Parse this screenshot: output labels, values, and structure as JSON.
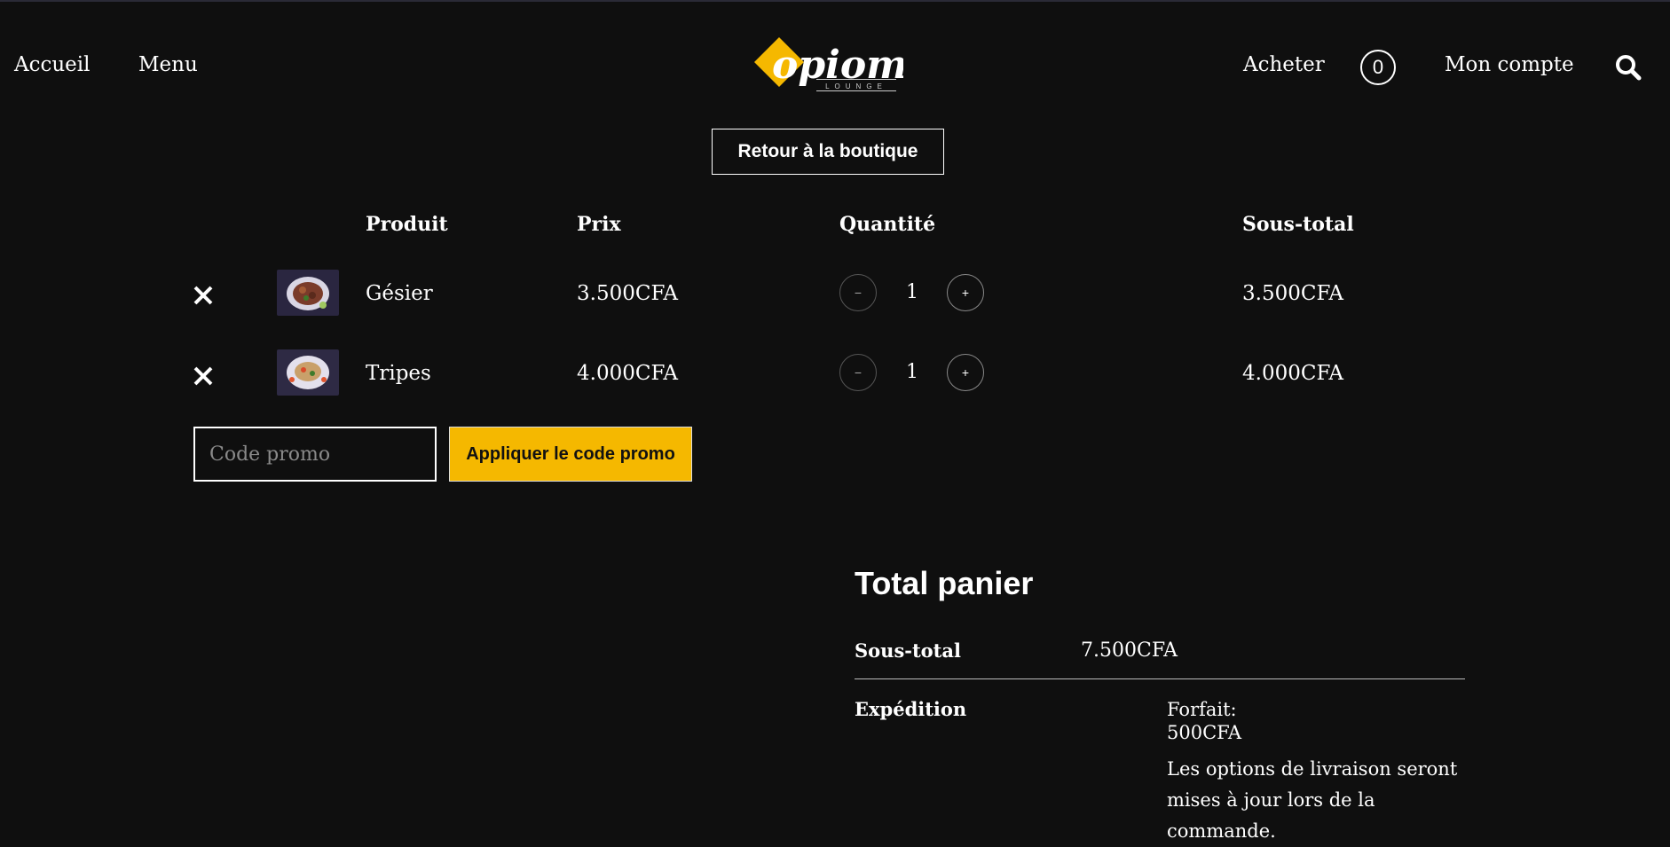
{
  "header": {
    "nav_left": [
      "Accueil",
      "Menu"
    ],
    "logo_text": "opiom",
    "logo_sub": "LOUNGE",
    "buy_label": "Acheter",
    "cart_count": "0",
    "account_label": "Mon compte"
  },
  "back_button": "Retour à la boutique",
  "table": {
    "headers": {
      "product": "Produit",
      "price": "Prix",
      "quantity": "Quantité",
      "subtotal": "Sous-total"
    },
    "rows": [
      {
        "product": "Gésier",
        "price": "3.500CFA",
        "quantity": "1",
        "subtotal": "3.500CFA"
      },
      {
        "product": "Tripes",
        "price": "4.000CFA",
        "quantity": "1",
        "subtotal": "4.000CFA"
      }
    ]
  },
  "promo": {
    "placeholder": "Code promo",
    "apply_label": "Appliquer le code promo"
  },
  "totals": {
    "title": "Total panier",
    "subtotal_label": "Sous-total",
    "subtotal_value": "7.500CFA",
    "shipping_label": "Expédition",
    "shipping_method": "Forfait:",
    "shipping_value": "500CFA",
    "shipping_note": "Les options de livraison seront mises à jour lors de la commande."
  },
  "colors": {
    "accent": "#f5b800",
    "background": "#0f0f0f"
  },
  "icons": {
    "remove": "close-icon",
    "search": "search-icon"
  }
}
